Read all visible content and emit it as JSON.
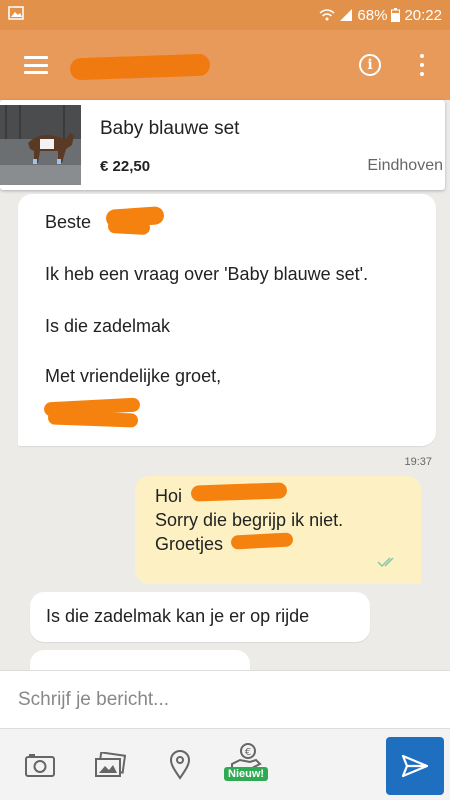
{
  "status_bar": {
    "battery": "68%",
    "time": "20:22"
  },
  "listing": {
    "title": "Baby blauwe set",
    "price": "€ 22,50",
    "location": "Eindhoven"
  },
  "messages": {
    "first": {
      "greeting": "Beste",
      "line1": "Ik heb een vraag over 'Baby blauwe set'.",
      "line2": "Is die zadelmak",
      "closing": "Met vriendelijke groet,"
    },
    "timestamp": "19:37",
    "reply": {
      "line1": "Hoi",
      "line2": "Sorry die begrijp ik niet.",
      "line3": "Groetjes"
    },
    "third": "Is die zadelmak kan je er op rijde"
  },
  "composer": {
    "placeholder": "Schrijf je bericht..."
  },
  "toolbar": {
    "badge": "Nieuw!"
  },
  "colors": {
    "status_bar": "#e2914a",
    "app_bar": "#e79a59",
    "outgoing_bubble": "#fdf1c4",
    "send_button": "#1e6fbf",
    "badge": "#2eaa52"
  },
  "icons": {
    "menu": "hamburger-icon",
    "info": "info-icon",
    "more": "more-vert-icon",
    "camera": "camera-icon",
    "gallery": "gallery-icon",
    "location": "location-pin-icon",
    "payment": "euro-hand-icon",
    "send": "send-icon"
  }
}
